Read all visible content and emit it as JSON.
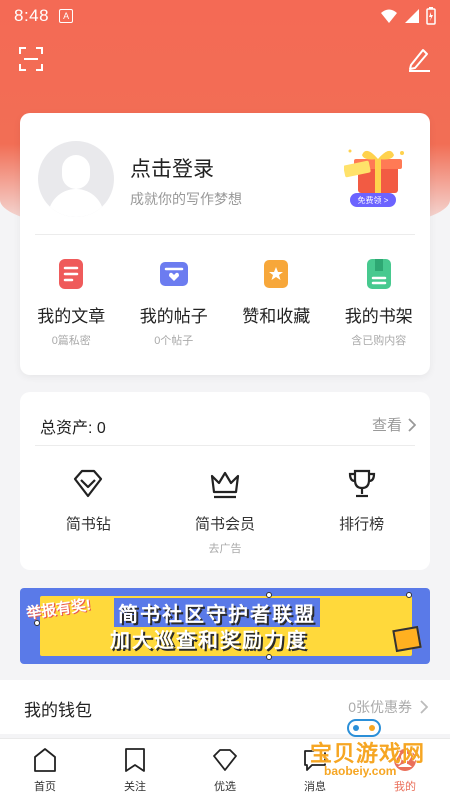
{
  "status": {
    "time": "8:48",
    "app_glyph": "A"
  },
  "header": {
    "scan_icon": "scan-icon",
    "edit_icon": "pencil-icon"
  },
  "profile": {
    "title": "点击登录",
    "subtitle": "成就你的写作梦想",
    "gift_badge": "免费领 >",
    "quick": [
      {
        "label": "我的文章",
        "sub": "0篇私密",
        "icon": "article-icon",
        "color": "#ef5b5b"
      },
      {
        "label": "我的帖子",
        "sub": "0个帖子",
        "icon": "post-icon",
        "color": "#6c7cf0"
      },
      {
        "label": "赞和收藏",
        "sub": "",
        "icon": "bookmark-star-icon",
        "color": "#f7a73a"
      },
      {
        "label": "我的书架",
        "sub": "含已购内容",
        "icon": "bookshelf-icon",
        "color": "#47c98f"
      }
    ]
  },
  "assets": {
    "title": "总资产: 0",
    "link": "查看",
    "items": [
      {
        "label": "简书钻",
        "sub": ""
      },
      {
        "label": "简书会员",
        "sub": "去广告"
      },
      {
        "label": "排行榜",
        "sub": ""
      }
    ]
  },
  "banner": {
    "tag": "举报有奖!",
    "line1": "简书社区守护者联盟",
    "line2": "加大巡查和奖励力度",
    "colors": {
      "outer": "#5a7ae8",
      "inner": "#ffd93b"
    }
  },
  "wallet": {
    "title": "我的钱包",
    "coupon": "0张优惠券"
  },
  "tabs": [
    {
      "label": "首页",
      "icon": "home-icon"
    },
    {
      "label": "关注",
      "icon": "bookmark-icon"
    },
    {
      "label": "优选",
      "icon": "diamond-icon"
    },
    {
      "label": "消息",
      "icon": "message-icon"
    },
    {
      "label": "我的",
      "icon": "profile-icon",
      "active": true
    }
  ],
  "watermark": {
    "title": "宝贝游戏网",
    "url": "baobeiy.com"
  },
  "colors": {
    "accent": "#f36b55",
    "active_tab": "#ea6f5a"
  }
}
